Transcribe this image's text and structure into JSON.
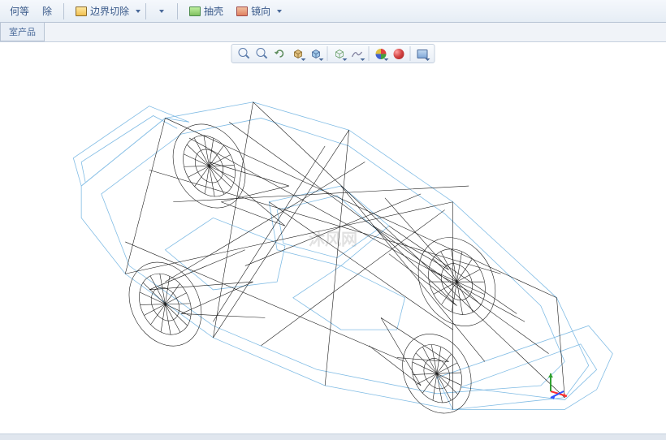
{
  "toolbar": {
    "btn1": "何等",
    "btn2": "除",
    "boundary_cut": "边界切除",
    "shell": "抽壳",
    "mirror": "镜向"
  },
  "tab": {
    "room_product": "室产品"
  },
  "view_tools": {
    "zoom_fit": "zoom-fit",
    "zoom_area": "zoom-area",
    "prev_view": "previous-view",
    "section": "section-view",
    "display_style": "display-style",
    "hide_show": "hide-show",
    "scene": "edit-scene",
    "appearance": "apply-appearance",
    "render": "render-settings",
    "screen": "screen-capture"
  },
  "watermark": "沐风网",
  "triad": {
    "x": "X",
    "y": "Y",
    "z": "Z"
  }
}
